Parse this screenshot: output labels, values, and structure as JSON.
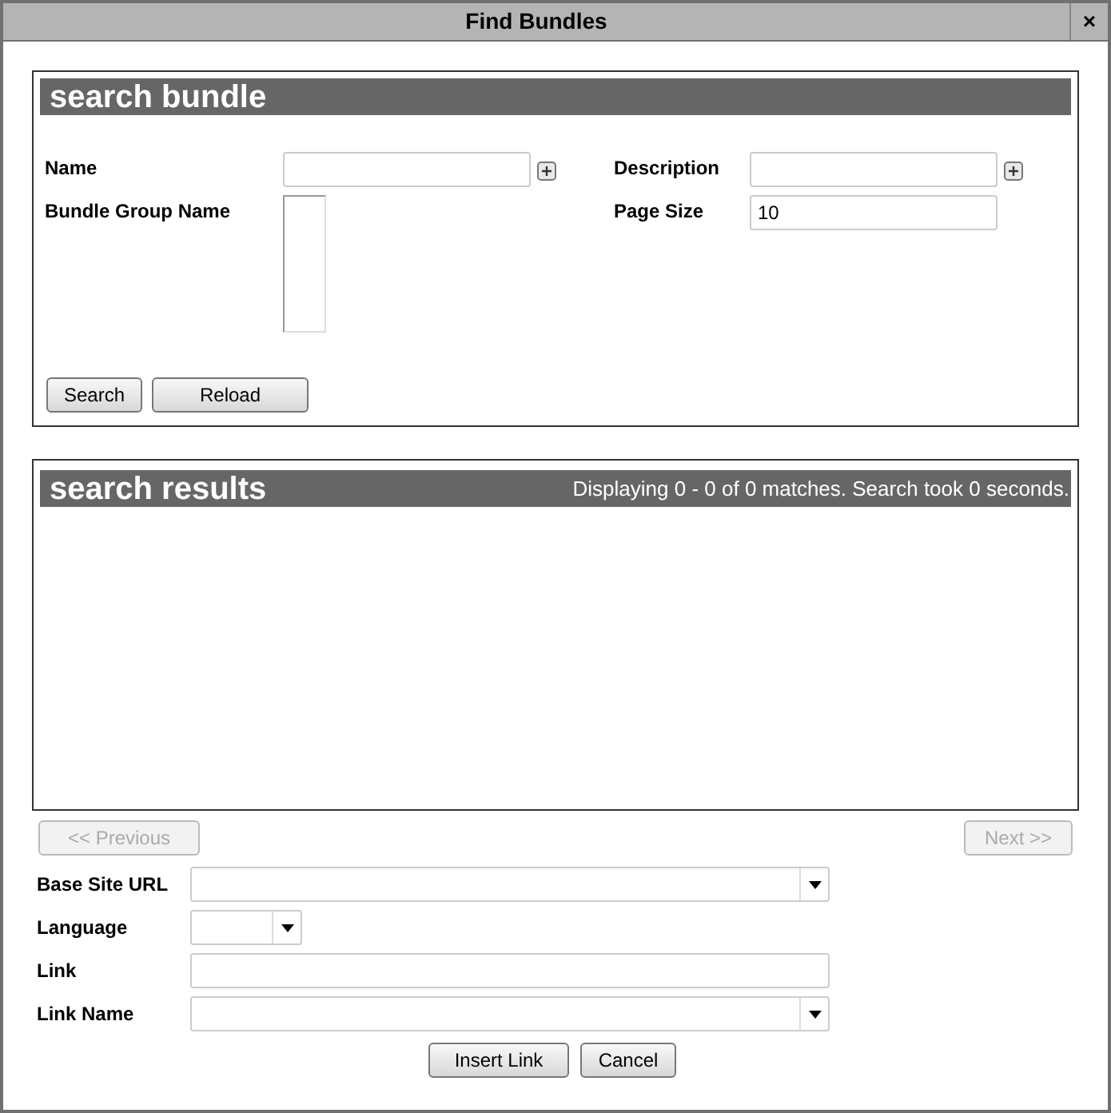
{
  "window": {
    "title": "Find Bundles",
    "close": "×"
  },
  "search_panel": {
    "title": "search bundle",
    "fields": [
      {
        "label": "Name",
        "kind": "text",
        "expandable": true
      },
      {
        "label": "Description",
        "kind": "text",
        "expandable": true
      },
      {
        "label": "Bundle Group Name",
        "kind": "list",
        "expandable": false
      },
      {
        "label": "Page Size",
        "kind": "text",
        "value": "10",
        "expandable": false
      }
    ],
    "buttons": [
      "Search",
      "Reload"
    ]
  },
  "results_panel": {
    "title": "search results",
    "summary": "Displaying 0 - 0 of 0 matches. Search took 0 seconds."
  },
  "pagination": [
    {
      "label": "<< Previous",
      "disabled": true
    },
    {
      "label": "Next >>",
      "disabled": true
    }
  ],
  "link_form": [
    {
      "label": "Base Site URL",
      "kind": "combo"
    },
    {
      "label": "Language",
      "kind": "dropdown"
    },
    {
      "label": "Link",
      "kind": "text"
    },
    {
      "label": "Link Name",
      "kind": "combo"
    }
  ],
  "buttons": [
    "Insert Link",
    "Cancel"
  ]
}
